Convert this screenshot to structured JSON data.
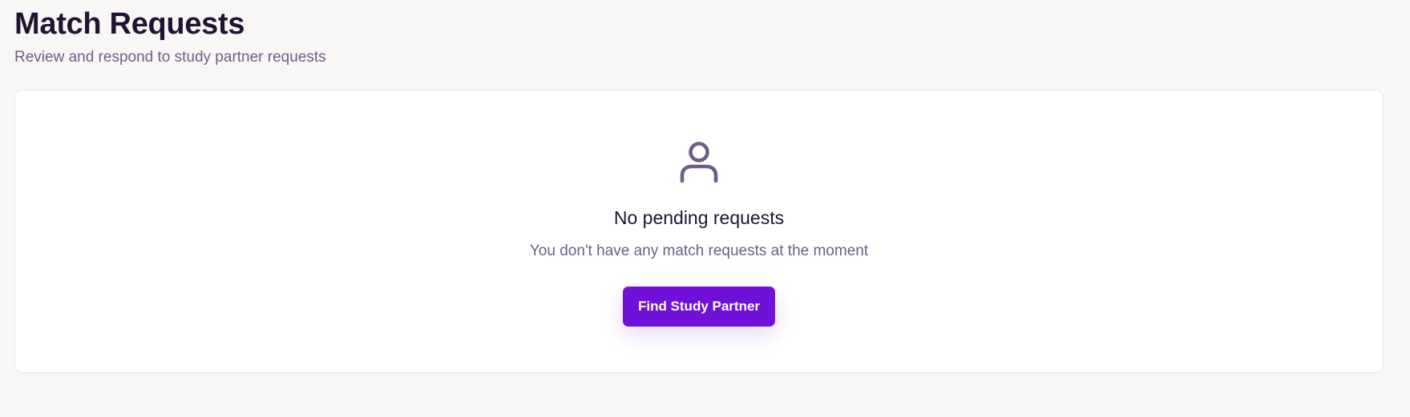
{
  "header": {
    "title": "Match Requests",
    "subtitle": "Review and respond to study partner requests"
  },
  "empty_state": {
    "icon": "user-icon",
    "title": "No pending requests",
    "description": "You don't have any match requests at the moment",
    "action_label": "Find Study Partner"
  },
  "colors": {
    "background": "#f8f7f6",
    "card": "#ffffff",
    "heading": "#1f1433",
    "muted_text": "#6e5f84",
    "accent": "#7010d8"
  }
}
